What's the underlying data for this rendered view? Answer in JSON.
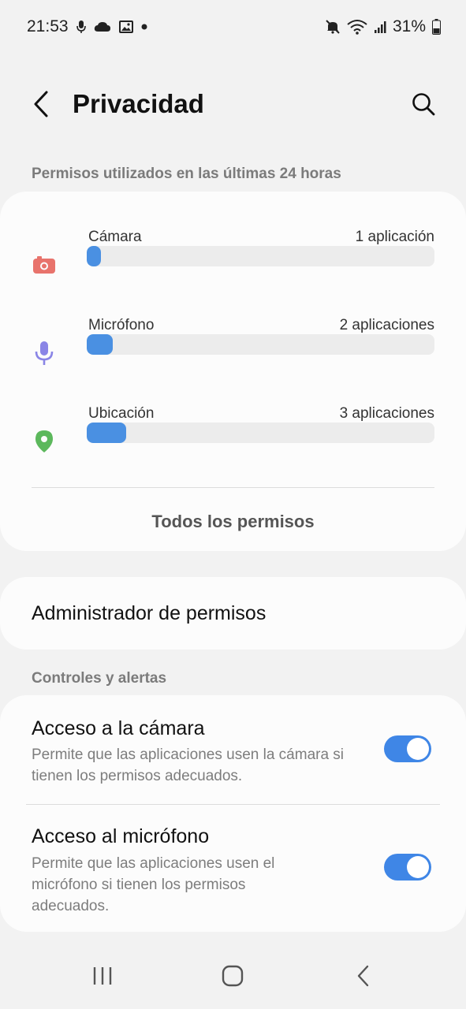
{
  "status_bar": {
    "time": "21:53",
    "left_icons": [
      "mic-icon",
      "cloud-icon",
      "image-icon",
      "dot-icon"
    ],
    "right_icons": [
      "mute-icon",
      "wifi-icon",
      "signal-icon",
      "battery-icon"
    ],
    "battery": "31%"
  },
  "header": {
    "title": "Privacidad",
    "back_icon": "back-arrow-icon",
    "search_icon": "search-icon"
  },
  "usage_section": {
    "label": "Permisos utilizados en las últimas 24 horas",
    "items": [
      {
        "name": "Cámara",
        "count": "1 aplicación",
        "icon": "camera-icon",
        "icon_color": "#e8736c",
        "fill": 0.04
      },
      {
        "name": "Micrófono",
        "count": "2 aplicaciones",
        "icon": "microphone-icon",
        "icon_color": "#8a85e6",
        "fill": 0.075
      },
      {
        "name": "Ubicación",
        "count": "3 aplicaciones",
        "icon": "location-pin-icon",
        "icon_color": "#5cb85c",
        "fill": 0.113
      }
    ],
    "all_permissions": "Todos los permisos"
  },
  "permission_manager": {
    "label": "Administrador de permisos"
  },
  "controls_section": {
    "label": "Controles y alertas",
    "toggles": [
      {
        "title": "Acceso a la cámara",
        "description": "Permite que las aplicaciones usen la cámara si tienen los permisos adecuados.",
        "enabled": true
      },
      {
        "title": "Acceso al micrófono",
        "description": "Permite que las aplicaciones usen el micrófono si tienen los permisos adecuados.",
        "enabled": true
      }
    ]
  },
  "nav_bar": {
    "buttons": [
      "recents-icon",
      "home-icon",
      "back-icon"
    ]
  },
  "colors": {
    "accent": "#3f86e6",
    "bar_fill": "#4a90e2",
    "background": "#f2f2f2",
    "card": "#fcfcfc"
  }
}
